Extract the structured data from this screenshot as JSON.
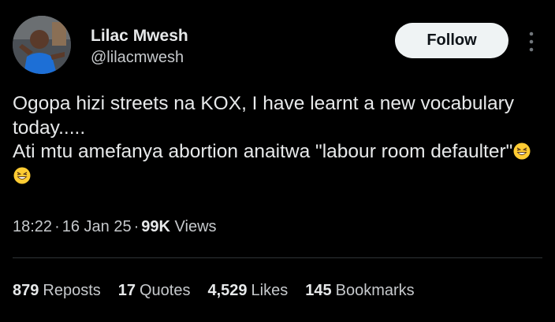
{
  "author": {
    "display_name": "Lilac Mwesh",
    "handle": "@lilacmwesh",
    "avatar_icon": "profile-photo"
  },
  "actions": {
    "follow_label": "Follow",
    "more_icon": "more-vertical-icon"
  },
  "tweet": {
    "line1": "Ogopa hizi streets na KOX, I have learnt a new vocabulary today.....",
    "line2": "Ati mtu amefanya abortion anaitwa \"labour room defaulter\"",
    "emojis": [
      "grinning-squinting-face-emoji",
      "grinning-squinting-face-emoji"
    ]
  },
  "meta": {
    "time": "18:22",
    "date": "16 Jan 25",
    "views_count": "99K",
    "views_label": "Views",
    "separator": "·"
  },
  "stats": [
    {
      "count": "879",
      "label": "Reposts"
    },
    {
      "count": "17",
      "label": "Quotes"
    },
    {
      "count": "4,529",
      "label": "Likes"
    },
    {
      "count": "145",
      "label": "Bookmarks"
    }
  ],
  "colors": {
    "background": "#000000",
    "primary_text": "#e7e9ea",
    "secondary_text": "#c6c9cc",
    "follow_bg": "#eff3f4",
    "divider": "#2f3336"
  }
}
